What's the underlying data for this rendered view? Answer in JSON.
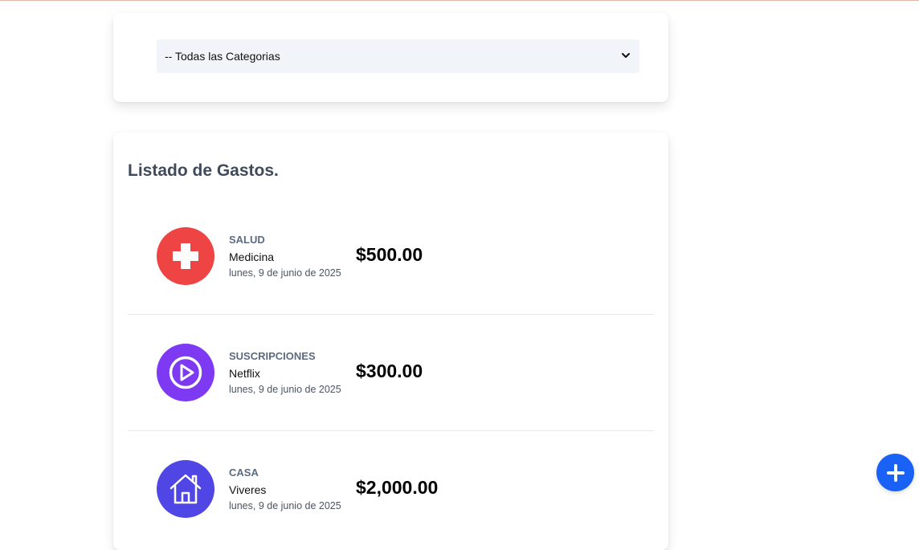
{
  "filter": {
    "selected": "-- Todas las Categorias"
  },
  "list": {
    "title": "Listado de Gastos.",
    "expenses": [
      {
        "category": "SALUD",
        "name": "Medicina",
        "date": "lunes, 9 de junio de 2025",
        "amount": "$500.00",
        "icon": "health-cross-icon",
        "color": "#ef4444"
      },
      {
        "category": "SUSCRIPCIONES",
        "name": "Netflix",
        "date": "lunes, 9 de junio de 2025",
        "amount": "$300.00",
        "icon": "play-icon",
        "color": "#7e3af2"
      },
      {
        "category": "CASA",
        "name": "Viveres",
        "date": "lunes, 9 de junio de 2025",
        "amount": "$2,000.00",
        "icon": "house-icon",
        "color": "#5046e5"
      }
    ]
  },
  "fab": {
    "icon": "plus-icon",
    "color": "#1a62f5"
  }
}
